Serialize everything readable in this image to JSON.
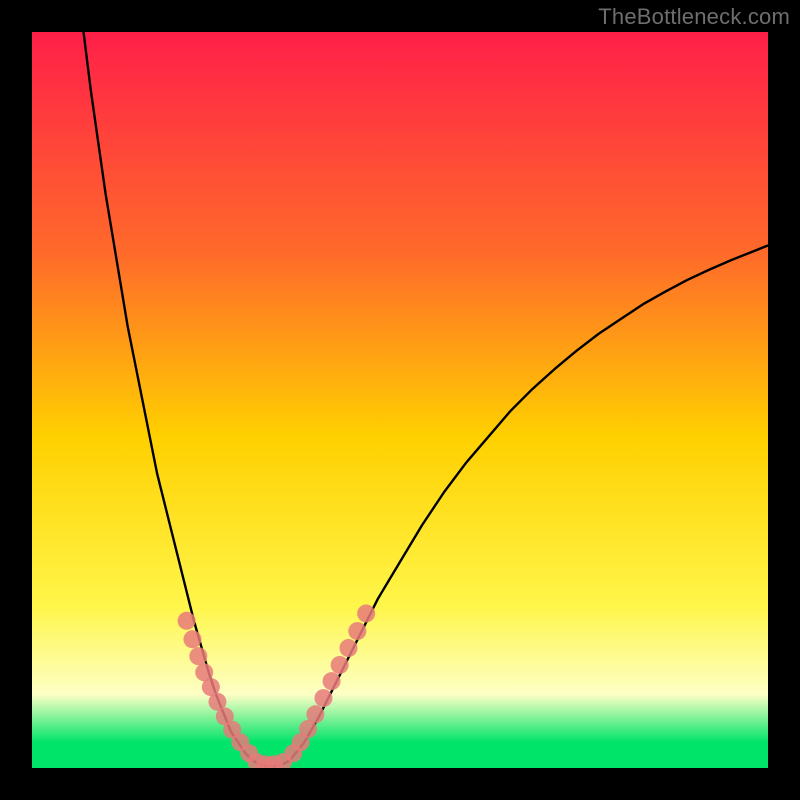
{
  "watermark": "TheBottleneck.com",
  "colors": {
    "frame_bg": "#000000",
    "gradient_top": "#ff1f49",
    "gradient_upper": "#ff6a2a",
    "gradient_mid": "#ffd000",
    "gradient_lower": "#fff64a",
    "gradient_pale": "#fdffc5",
    "gradient_green": "#00e46a",
    "curve_stroke": "#000000",
    "dot_fill": "#e77a7a"
  },
  "chart_data": {
    "type": "line",
    "title": "",
    "xlabel": "",
    "ylabel": "",
    "xlim": [
      0,
      100
    ],
    "ylim": [
      0,
      100
    ],
    "series": [
      {
        "name": "left-branch",
        "x": [
          7,
          8,
          9,
          10,
          11,
          12,
          13,
          14,
          15,
          16,
          17,
          18,
          19,
          20,
          21,
          22,
          23,
          24,
          25,
          26,
          27,
          28,
          29,
          30
        ],
        "y": [
          100,
          92,
          85,
          78,
          72,
          66,
          60,
          55,
          50,
          45,
          40,
          36,
          32,
          28,
          24,
          20,
          16.5,
          13,
          10,
          7.5,
          5,
          3.5,
          2,
          1
        ]
      },
      {
        "name": "trough",
        "x": [
          30,
          31,
          32,
          33,
          34,
          35
        ],
        "y": [
          1,
          0.5,
          0.3,
          0.3,
          0.5,
          1
        ]
      },
      {
        "name": "right-branch",
        "x": [
          35,
          37,
          39,
          41,
          43,
          45,
          47,
          50,
          53,
          56,
          59,
          62,
          65,
          68,
          71,
          74,
          77,
          80,
          83,
          86,
          89,
          92,
          95,
          98,
          100
        ],
        "y": [
          1,
          3.5,
          7,
          11,
          15,
          19,
          23,
          28,
          33,
          37.5,
          41.5,
          45,
          48.5,
          51.5,
          54.2,
          56.7,
          59,
          61,
          63,
          64.7,
          66.3,
          67.7,
          69,
          70.2,
          71
        ]
      }
    ],
    "dots_left": {
      "name": "left-cluster",
      "x": [
        21,
        21.8,
        22.6,
        23.4,
        24.3,
        25.2,
        26.2,
        27.2,
        28.3,
        29.5
      ],
      "y": [
        20,
        17.5,
        15.2,
        13,
        11,
        9,
        7,
        5.2,
        3.5,
        2
      ]
    },
    "dots_right": {
      "name": "right-cluster",
      "x": [
        35.5,
        36.5,
        37.5,
        38.5,
        39.6,
        40.7,
        41.8,
        43,
        44.2,
        45.4
      ],
      "y": [
        2,
        3.5,
        5.3,
        7.3,
        9.5,
        11.8,
        14,
        16.3,
        18.6,
        21
      ]
    },
    "dots_trough": {
      "name": "trough-cluster",
      "x": [
        30.5,
        31.7,
        32.9,
        34.1
      ],
      "y": [
        0.8,
        0.5,
        0.5,
        0.8
      ]
    },
    "gradient_stops": [
      {
        "offset": 0.0,
        "key": "gradient_top"
      },
      {
        "offset": 0.3,
        "key": "gradient_upper"
      },
      {
        "offset": 0.55,
        "key": "gradient_mid"
      },
      {
        "offset": 0.78,
        "key": "gradient_lower"
      },
      {
        "offset": 0.9,
        "key": "gradient_pale"
      },
      {
        "offset": 0.965,
        "key": "gradient_green"
      },
      {
        "offset": 1.0,
        "key": "gradient_green"
      }
    ]
  }
}
